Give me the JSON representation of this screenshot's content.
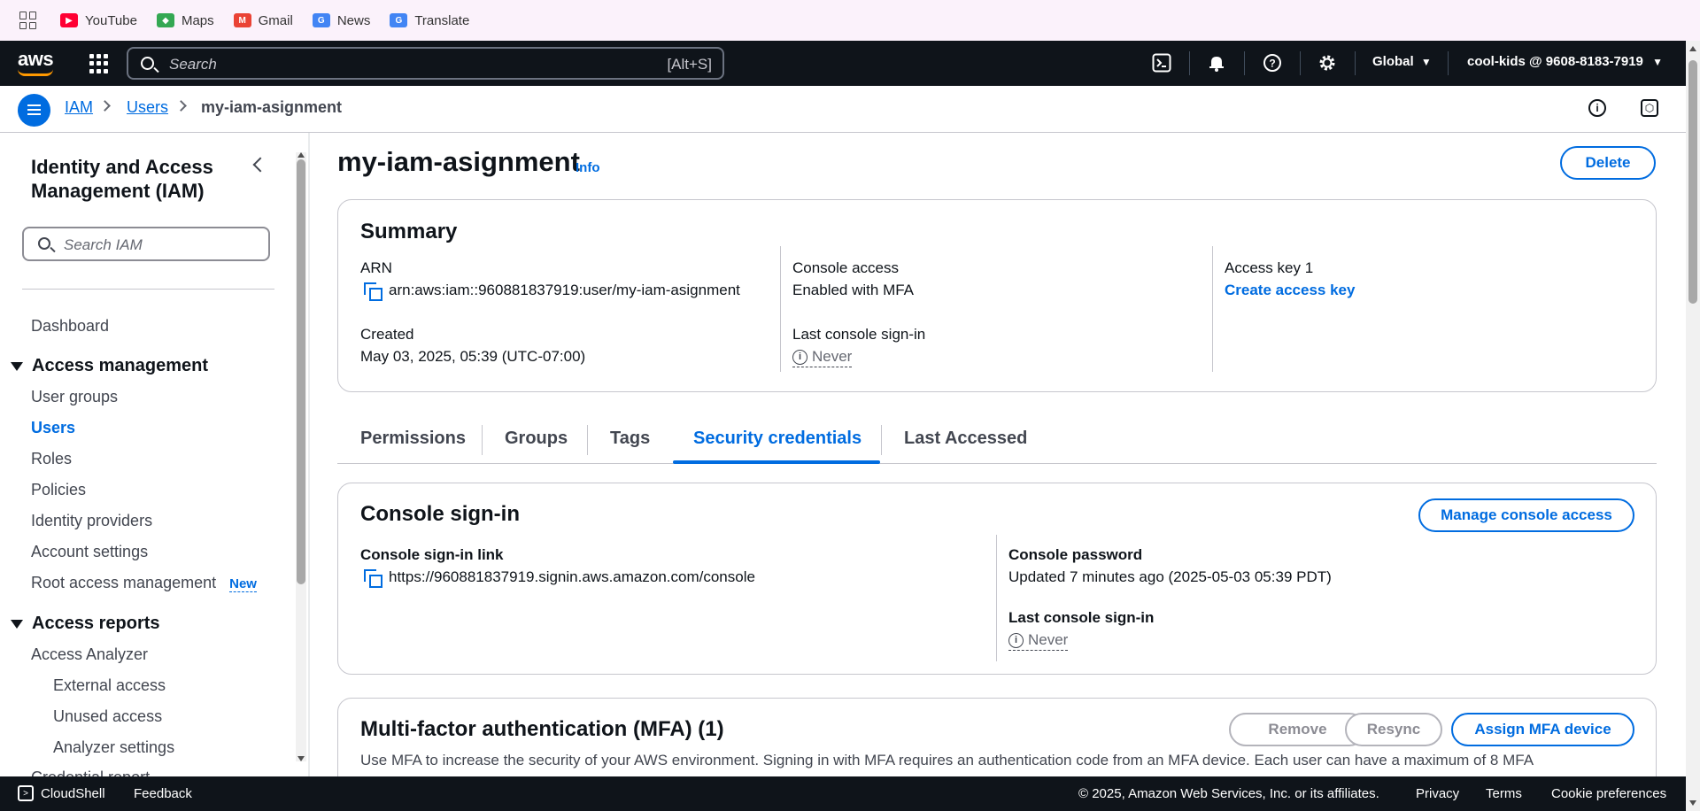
{
  "bookmarks": {
    "items": [
      {
        "label": "YouTube",
        "icon": "youtube-icon",
        "color": "#ff0033"
      },
      {
        "label": "Maps",
        "icon": "maps-icon",
        "color": "#34a853"
      },
      {
        "label": "Gmail",
        "icon": "gmail-icon",
        "color": "#ea4335"
      },
      {
        "label": "News",
        "icon": "news-icon",
        "color": "#4285f4"
      },
      {
        "label": "Translate",
        "icon": "translate-icon",
        "color": "#4285f4"
      }
    ]
  },
  "topnav": {
    "logo": "aws",
    "search_placeholder": "Search",
    "search_shortcut": "[Alt+S]",
    "region": "Global",
    "account": "cool-kids @ 9608-8183-7919"
  },
  "breadcrumb": {
    "items": [
      "IAM",
      "Users",
      "my-iam-asignment"
    ]
  },
  "sidebar": {
    "title": "Identity and Access Management (IAM)",
    "search_placeholder": "Search IAM",
    "dashboard": "Dashboard",
    "access_management": {
      "label": "Access management",
      "items": [
        "User groups",
        "Users",
        "Roles",
        "Policies",
        "Identity providers",
        "Account settings",
        "Root access management"
      ],
      "active": "Users",
      "new_badge": "New"
    },
    "access_reports": {
      "label": "Access reports",
      "analyzer": "Access Analyzer",
      "sub_items": [
        "External access",
        "Unused access",
        "Analyzer settings"
      ],
      "cut_off": "Credential report"
    }
  },
  "main": {
    "title": "my-iam-asignment",
    "info": "Info",
    "delete": "Delete",
    "summary": {
      "title": "Summary",
      "arn_label": "ARN",
      "arn_value": "arn:aws:iam::960881837919:user/my-iam-asignment",
      "created_label": "Created",
      "created_value": "May 03, 2025, 05:39 (UTC-07:00)",
      "console_access_label": "Console access",
      "console_access_value": "Enabled with MFA",
      "last_signin_label": "Last console sign-in",
      "last_signin_value": "Never",
      "access_key_label": "Access key 1",
      "access_key_link": "Create access key"
    },
    "tabs": [
      "Permissions",
      "Groups",
      "Tags",
      "Security credentials",
      "Last Accessed"
    ],
    "active_tab": "Security credentials",
    "console_signin": {
      "title": "Console sign-in",
      "manage_button": "Manage console access",
      "link_label": "Console sign-in link",
      "link_value": "https://960881837919.signin.aws.amazon.com/console",
      "password_label": "Console password",
      "password_value": "Updated 7 minutes ago (2025-05-03 05:39 PDT)",
      "last_signin_label": "Last console sign-in",
      "last_signin_value": "Never"
    },
    "mfa": {
      "title": "Multi-factor authentication (MFA) (1)",
      "remove": "Remove",
      "resync": "Resync",
      "assign": "Assign MFA device",
      "description": "Use MFA to increase the security of your AWS environment. Signing in with MFA requires an authentication code from an MFA device. Each user can have a maximum of 8 MFA"
    }
  },
  "footer": {
    "cloudshell": "CloudShell",
    "feedback": "Feedback",
    "copyright": "© 2025, Amazon Web Services, Inc. or its affiliates.",
    "privacy": "Privacy",
    "terms": "Terms",
    "cookies": "Cookie preferences"
  },
  "colors": {
    "accent": "#006ce0",
    "nav_bg": "#0f141a",
    "aws_orange": "#ff9900"
  }
}
